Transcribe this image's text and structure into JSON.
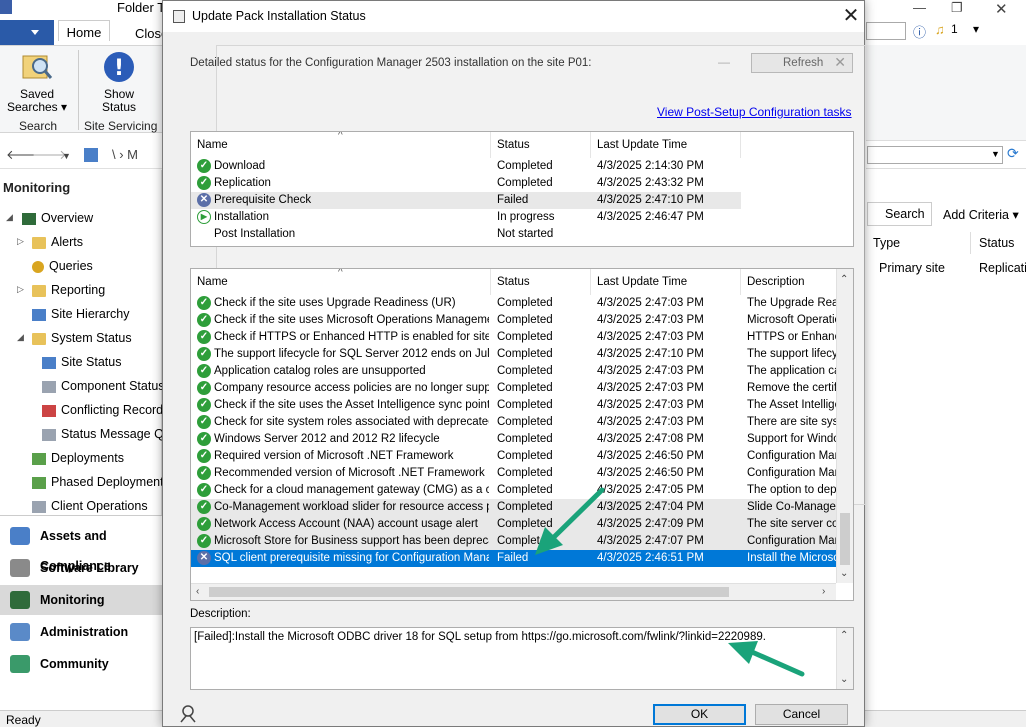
{
  "background": {
    "window_title_fragment": "Folder To",
    "ribbon_tabs": [
      "Home",
      "Close"
    ],
    "ribbon_buttons": [
      {
        "label": "Saved Searches ▾",
        "icon": "saved-searches-icon"
      },
      {
        "label": "Show Status",
        "icon": "show-status-icon"
      }
    ],
    "ribbon_groups": [
      "Search",
      "Site Servicing"
    ],
    "address_path": "\\  ›  M",
    "nav_header": "Monitoring",
    "tree": [
      {
        "label": "Overview",
        "icon": "overview-icon"
      },
      {
        "label": "Alerts",
        "icon": "folder-icon"
      },
      {
        "label": "Queries",
        "icon": "queries-icon"
      },
      {
        "label": "Reporting",
        "icon": "folder-icon"
      },
      {
        "label": "Site Hierarchy",
        "icon": "site-hierarchy-icon"
      },
      {
        "label": "System Status",
        "icon": "folder-icon"
      },
      {
        "label": "Site Status",
        "icon": "site-status-icon"
      },
      {
        "label": "Component Status",
        "icon": "component-status-icon"
      },
      {
        "label": "Conflicting Records",
        "icon": "conflicting-records-icon"
      },
      {
        "label": "Status Message Qu",
        "icon": "status-message-icon"
      },
      {
        "label": "Deployments",
        "icon": "deployments-icon"
      },
      {
        "label": "Phased Deployments",
        "icon": "phased-deployments-icon"
      },
      {
        "label": "Client Operations",
        "icon": "client-operations-icon"
      }
    ],
    "workspaces": [
      {
        "label": "Assets and Compliance",
        "active": false
      },
      {
        "label": "Software Library",
        "active": false
      },
      {
        "label": "Monitoring",
        "active": true
      },
      {
        "label": "Administration",
        "active": false
      },
      {
        "label": "Community",
        "active": false
      }
    ],
    "status_bar": "Ready",
    "right_search_button": "Search",
    "right_add_criteria": "Add Criteria ▾",
    "right_columns": [
      "Type",
      "Status"
    ],
    "right_row": {
      "type": "Primary site",
      "status": "Replicating"
    },
    "notification_count": "1"
  },
  "dialog": {
    "title": "Update Pack Installation Status",
    "detail_text": "Detailed status for the Configuration Manager 2503 installation on the site P01:",
    "refresh_label": "Refresh",
    "link_text": "View Post-Setup Configuration tasks",
    "top_table": {
      "columns": [
        "Name",
        "Status",
        "Last Update Time"
      ],
      "rows": [
        {
          "icon": "completed",
          "name": "Download",
          "status": "Completed",
          "time": "4/3/2025 2:14:30 PM"
        },
        {
          "icon": "completed",
          "name": "Replication",
          "status": "Completed",
          "time": "4/3/2025 2:43:32 PM"
        },
        {
          "icon": "failed",
          "name": "Prerequisite Check",
          "status": "Failed",
          "time": "4/3/2025 2:47:10 PM"
        },
        {
          "icon": "in-progress",
          "name": "Installation",
          "status": "In progress",
          "time": "4/3/2025 2:46:47 PM"
        },
        {
          "icon": "none",
          "name": "Post Installation",
          "status": "Not started",
          "time": ""
        }
      ]
    },
    "bottom_table": {
      "columns": [
        "Name",
        "Status",
        "Last Update Time",
        "Description"
      ],
      "rows": [
        {
          "icon": "completed",
          "name": "Check if the site uses Upgrade Readiness (UR)",
          "status": "Completed",
          "time": "4/3/2025 2:47:03 PM",
          "desc": "The Upgrade Read"
        },
        {
          "icon": "completed",
          "name": "Check if the site uses Microsoft Operations Management...",
          "status": "Completed",
          "time": "4/3/2025 2:47:03 PM",
          "desc": "Microsoft Operation"
        },
        {
          "icon": "completed",
          "name": "Check if HTTPS or Enhanced HTTP is enabled for site s...",
          "status": "Completed",
          "time": "4/3/2025 2:47:03 PM",
          "desc": "HTTPS or Enhanc"
        },
        {
          "icon": "completed",
          "name": "The support lifecycle for SQL Server 2012 ends on July ...",
          "status": "Completed",
          "time": "4/3/2025 2:47:10 PM",
          "desc": "The support lifecyc"
        },
        {
          "icon": "completed",
          "name": "Application catalog roles are unsupported",
          "status": "Completed",
          "time": "4/3/2025 2:47:03 PM",
          "desc": "The application ca"
        },
        {
          "icon": "completed",
          "name": "Company resource access policies are no longer support...",
          "status": "Completed",
          "time": "4/3/2025 2:47:03 PM",
          "desc": "Remove the certifi"
        },
        {
          "icon": "completed",
          "name": "Check if the site uses the Asset Intelligence sync point role",
          "status": "Completed",
          "time": "4/3/2025 2:47:03 PM",
          "desc": "The Asset Intellige"
        },
        {
          "icon": "completed",
          "name": "Check for site system roles associated with deprecated o...",
          "status": "Completed",
          "time": "4/3/2025 2:47:03 PM",
          "desc": "There are site syst"
        },
        {
          "icon": "completed",
          "name": "Windows Server 2012 and 2012 R2 lifecycle",
          "status": "Completed",
          "time": "4/3/2025 2:47:08 PM",
          "desc": "Support for Window"
        },
        {
          "icon": "completed",
          "name": "Required version of Microsoft .NET Framework",
          "status": "Completed",
          "time": "4/3/2025 2:46:50 PM",
          "desc": "Configuration Mana"
        },
        {
          "icon": "completed",
          "name": "Recommended version of Microsoft .NET Framework",
          "status": "Completed",
          "time": "4/3/2025 2:46:50 PM",
          "desc": "Configuration Mana"
        },
        {
          "icon": "completed",
          "name": "Check for a cloud management gateway (CMG) as a clo...",
          "status": "Completed",
          "time": "4/3/2025 2:47:05 PM",
          "desc": "The option to deplo"
        },
        {
          "icon": "completed",
          "name": "Co-Management workload slider for resource access poli...",
          "status": "Completed",
          "time": "4/3/2025 2:47:04 PM",
          "desc": "Slide Co-Managem"
        },
        {
          "icon": "completed",
          "name": "Network Access Account (NAA) account usage alert",
          "status": "Completed",
          "time": "4/3/2025 2:47:09 PM",
          "desc": "The site server cor"
        },
        {
          "icon": "completed",
          "name": "Microsoft Store for Business support has been deprecated.",
          "status": "Completed",
          "time": "4/3/2025 2:47:07 PM",
          "desc": "Configuration Mana"
        },
        {
          "icon": "failed",
          "name": "SQL client prerequisite missing for Configuration Manage...",
          "status": "Failed",
          "time": "4/3/2025 2:46:51 PM",
          "desc": "Install the Microsof"
        }
      ]
    },
    "description_label": "Description:",
    "description_text": "[Failed]:Install the Microsoft ODBC driver 18 for SQL setup from https://go.microsoft.com/fwlink/?linkid=2220989.",
    "ok_label": "OK",
    "cancel_label": "Cancel"
  },
  "colors": {
    "selection": "#0078d7",
    "completed_icon": "#2e9e3a",
    "failed_icon": "#5b6fa8",
    "annotation_arrow": "#1aa37a",
    "link": "#0000ee"
  }
}
